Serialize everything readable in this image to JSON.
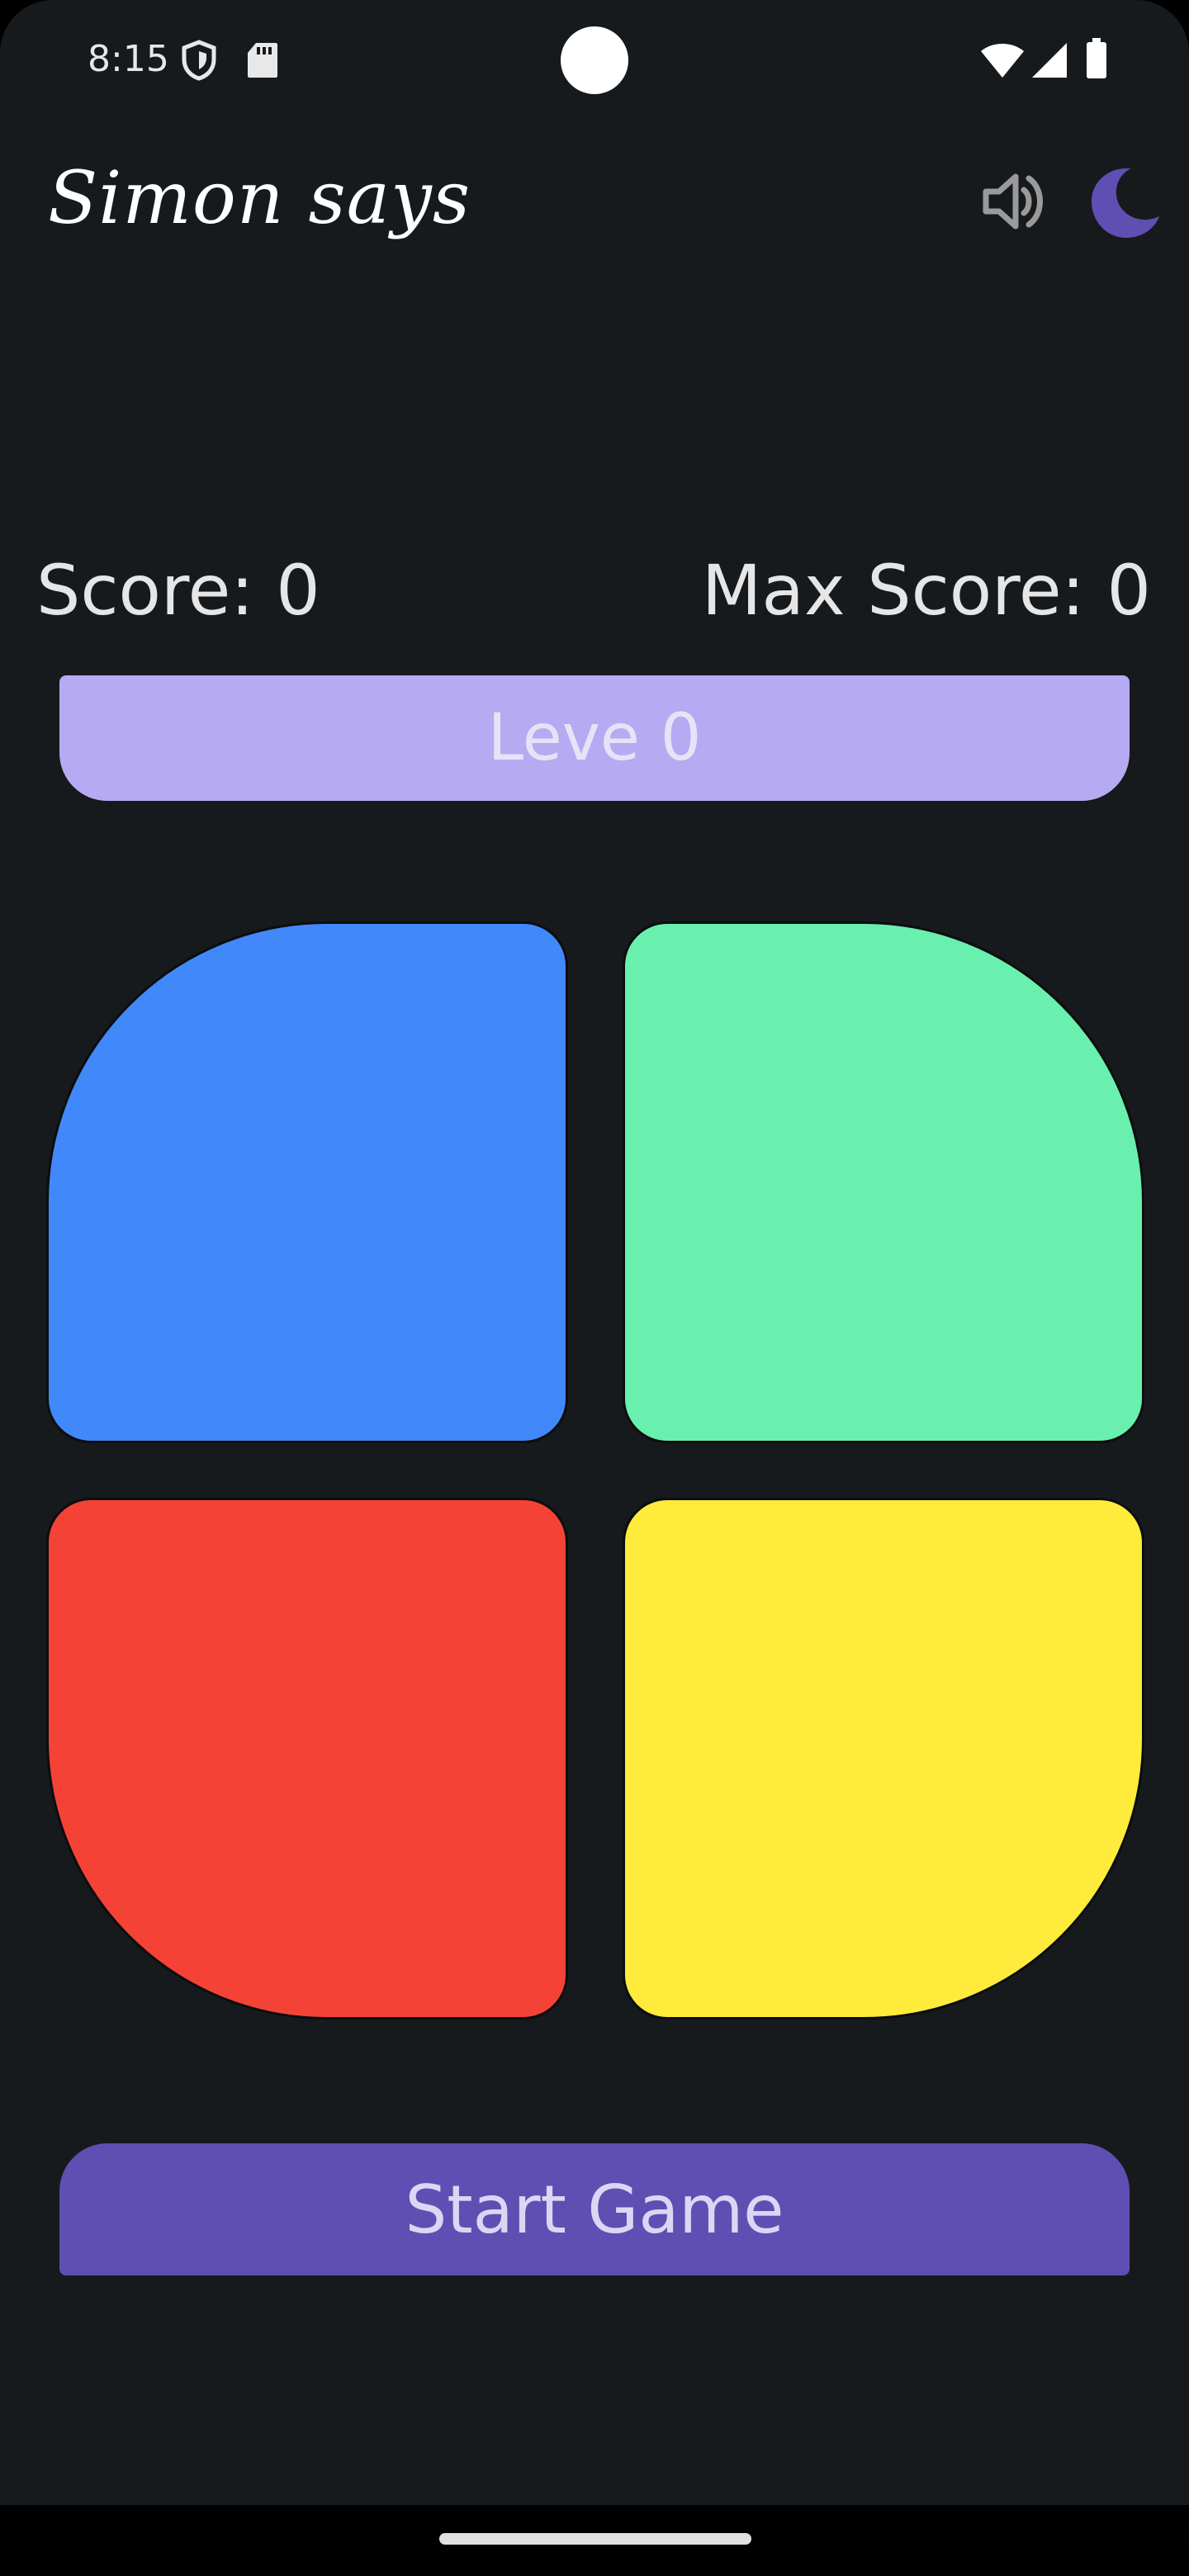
{
  "status_bar": {
    "time": "8:15",
    "icons": [
      "shield-icon",
      "sd-card-icon",
      "wifi-icon",
      "signal-icon",
      "battery-icon"
    ]
  },
  "header": {
    "title": "Simon says",
    "sound_icon": "volume-up-icon",
    "theme_icon": "moon-icon"
  },
  "scores": {
    "score": "Score: 0",
    "max_score": "Max Score: 0"
  },
  "level": {
    "label": "Leve 0"
  },
  "pads": {
    "blue": "#4188fb",
    "green": "#69f0ae",
    "red": "#f44336",
    "yellow": "#ffeb3b"
  },
  "start_button": {
    "label": "Start Game"
  },
  "colors": {
    "background": "#171a1d",
    "level_bar": "#b6aaf2",
    "accent": "#5f4fb2"
  }
}
